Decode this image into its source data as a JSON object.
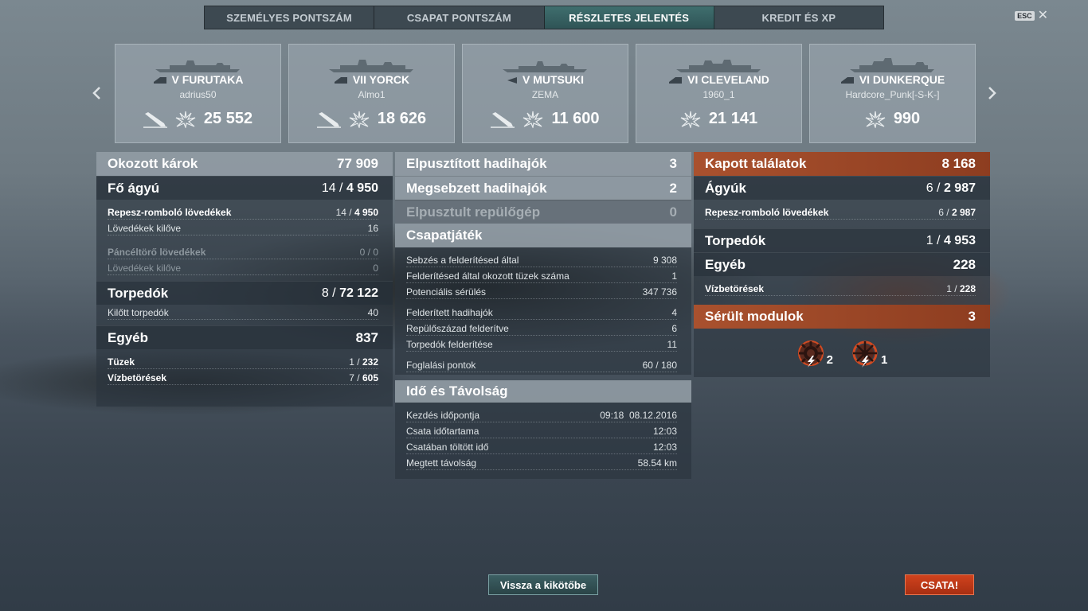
{
  "tabs": [
    {
      "label": "SZEMÉLYES PONTSZÁM"
    },
    {
      "label": "CSAPAT PONTSZÁM"
    },
    {
      "label": "RÉSZLETES JELENTÉS"
    },
    {
      "label": "KREDIT ÉS XP"
    }
  ],
  "esc": {
    "key": "ESC",
    "close": "✕"
  },
  "nav": {
    "prev": "‹",
    "next": "›"
  },
  "ships": [
    {
      "tier_name": "V FURUTAKA",
      "player": "adrius50",
      "score": "25 552",
      "class_icon": "cruiser-icon"
    },
    {
      "tier_name": "VII YORCK",
      "player": "Almo1",
      "score": "18 626",
      "class_icon": "cruiser-icon"
    },
    {
      "tier_name": "V MUTSUKI",
      "player": "ZEMA",
      "score": "11 600",
      "class_icon": "destroyer-icon"
    },
    {
      "tier_name": "VI CLEVELAND",
      "player": "1960_1",
      "score": "21 141",
      "class_icon": "cruiser-icon"
    },
    {
      "tier_name": "VI DUNKERQUE",
      "player": "Hardcore_Punk[-S-K-]",
      "score": "990",
      "class_icon": "battleship-icon"
    }
  ],
  "damage": {
    "title": "Okozott károk",
    "total": "77 909",
    "main": {
      "label": "Fő ágyú",
      "hits": "14",
      "dmg": "4 950"
    },
    "he": {
      "label": "Repesz-romboló lövedékek",
      "hits": "14",
      "dmg": "4 950"
    },
    "he_fired": {
      "label": "Lövedékek kilőve",
      "value": "16"
    },
    "ap": {
      "label": "Páncéltörő lövedékek",
      "value": "0 / 0"
    },
    "ap_fired": {
      "label": "Lövedékek kilőve",
      "value": "0"
    },
    "torp": {
      "label": "Torpedók",
      "hits": "8",
      "dmg": "72 122"
    },
    "torp_fired": {
      "label": "Kilőtt torpedók",
      "value": "40"
    },
    "other": {
      "label": "Egyéb",
      "value": "837"
    },
    "fires": {
      "label": "Tüzek",
      "hits": "1",
      "dmg": "232"
    },
    "floods": {
      "label": "Vízbetörések",
      "hits": "7",
      "dmg": "605"
    }
  },
  "kills": {
    "destroyed": {
      "label": "Elpusztított hadihajók",
      "value": "3"
    },
    "damaged": {
      "label": "Megsebzett hadihajók",
      "value": "2"
    },
    "planes": {
      "label": "Elpusztult repülőgép",
      "value": "0"
    }
  },
  "team": {
    "title": "Csapatjáték",
    "items": [
      {
        "label": "Sebzés a felderítésed által",
        "value": "9 308"
      },
      {
        "label": "Felderítésed által okozott tüzek száma",
        "value": "1"
      },
      {
        "label": "Potenciális sérülés",
        "value": "347 736"
      }
    ],
    "items2": [
      {
        "label": "Felderített hadihajók",
        "value": "4"
      },
      {
        "label": "Repülőszázad felderítve",
        "value": "6"
      },
      {
        "label": "Torpedók felderítése",
        "value": "11"
      }
    ],
    "cap": {
      "label": "Foglalási pontok",
      "value": "60 / 180"
    }
  },
  "time": {
    "title": "Idő és Távolság",
    "start": {
      "label": "Kezdés időpontja",
      "time": "09:18",
      "date": "08.12.2016"
    },
    "duration": {
      "label": "Csata időtartama",
      "value": "12:03"
    },
    "in_battle": {
      "label": "Csatában töltött idő",
      "value": "12:03"
    },
    "distance": {
      "label": "Megtett távolság",
      "value": "58.54 km"
    }
  },
  "received": {
    "title": "Kapott találatok",
    "total": "8 168",
    "guns": {
      "label": "Ágyúk",
      "hits": "6",
      "dmg": "2 987"
    },
    "he": {
      "label": "Repesz-romboló lövedékek",
      "hits": "6",
      "dmg": "2 987"
    },
    "torp": {
      "label": "Torpedók",
      "hits": "1",
      "dmg": "4 953"
    },
    "other": {
      "label": "Egyéb",
      "value": "228"
    },
    "floods": {
      "label": "Vízbetörések",
      "hits": "1",
      "dmg": "228"
    },
    "modules": {
      "label": "Sérült modulok",
      "value": "3"
    },
    "module_icons": [
      {
        "icon": "engine-damaged-icon",
        "count": "2"
      },
      {
        "icon": "steering-damaged-icon",
        "count": "1"
      }
    ]
  },
  "buttons": {
    "port": "Vissza a kikötőbe",
    "battle": "CSATA!"
  }
}
